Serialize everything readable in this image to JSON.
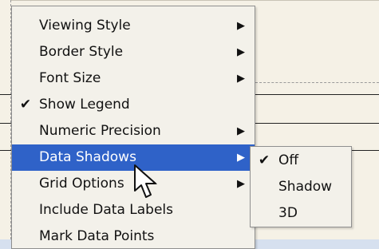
{
  "menu": {
    "items": [
      {
        "label": "Viewing Style",
        "has_submenu": true,
        "checked": false,
        "highlighted": false
      },
      {
        "label": "Border Style",
        "has_submenu": true,
        "checked": false,
        "highlighted": false
      },
      {
        "label": "Font Size",
        "has_submenu": true,
        "checked": false,
        "highlighted": false
      },
      {
        "label": "Show Legend",
        "has_submenu": false,
        "checked": true,
        "highlighted": false
      },
      {
        "label": "Numeric Precision",
        "has_submenu": true,
        "checked": false,
        "highlighted": false
      },
      {
        "label": "Data Shadows",
        "has_submenu": true,
        "checked": false,
        "highlighted": true
      },
      {
        "label": "Grid Options",
        "has_submenu": true,
        "checked": false,
        "highlighted": false
      },
      {
        "label": "Include Data Labels",
        "has_submenu": false,
        "checked": false,
        "highlighted": false
      },
      {
        "label": "Mark Data Points",
        "has_submenu": false,
        "checked": false,
        "highlighted": false
      }
    ],
    "highlight_color": "#2f62c8"
  },
  "submenu": {
    "items": [
      {
        "label": "Off",
        "checked": true
      },
      {
        "label": "Shadow",
        "checked": false
      },
      {
        "label": "3D",
        "checked": false
      }
    ]
  },
  "glyphs": {
    "check": "✔",
    "submenu_arrow": "▶"
  }
}
